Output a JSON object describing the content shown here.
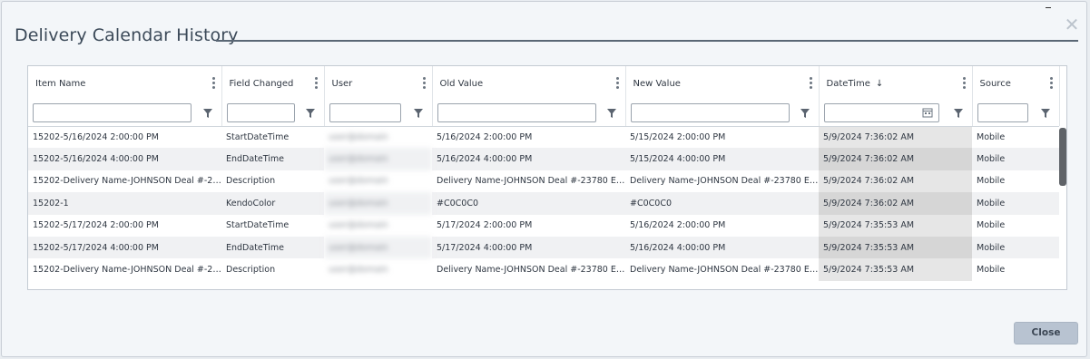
{
  "dialog": {
    "title": "Delivery Calendar History",
    "close_label": "Close"
  },
  "grid": {
    "columns": [
      {
        "label": "Item Name"
      },
      {
        "label": "Field Changed"
      },
      {
        "label": "User"
      },
      {
        "label": "Old Value"
      },
      {
        "label": "New Value"
      },
      {
        "label": "DateTime",
        "sort": "↓"
      },
      {
        "label": "Source"
      }
    ],
    "rows": [
      {
        "item": "15202-5/16/2024 2:00:00 PM",
        "field": "StartDateTime",
        "user": "user@domain",
        "old": "5/16/2024 2:00:00 PM",
        "new": "5/15/2024 2:00:00 PM",
        "datetime": "5/9/2024 7:36:02 AM",
        "source": "Mobile"
      },
      {
        "item": "15202-5/16/2024 4:00:00 PM",
        "field": "EndDateTime",
        "user": "user@domain",
        "old": "5/16/2024 4:00:00 PM",
        "new": "5/15/2024 4:00:00 PM",
        "datetime": "5/9/2024 7:36:02 AM",
        "source": "Mobile"
      },
      {
        "item": "15202-Delivery Name-JOHNSON Deal #-237...",
        "field": "Description",
        "user": "user@domain",
        "old": "Delivery Name-JOHNSON Deal #-23780 Enti...",
        "new": "Delivery Name-JOHNSON Deal #-23780 Enti...",
        "datetime": "5/9/2024 7:36:02 AM",
        "source": "Mobile"
      },
      {
        "item": "15202-1",
        "field": "KendoColor",
        "user": "user@domain",
        "old": "#C0C0C0",
        "new": "#C0C0C0",
        "datetime": "5/9/2024 7:36:02 AM",
        "source": "Mobile"
      },
      {
        "item": "15202-5/17/2024 2:00:00 PM",
        "field": "StartDateTime",
        "user": "user@domain",
        "old": "5/17/2024 2:00:00 PM",
        "new": "5/16/2024 2:00:00 PM",
        "datetime": "5/9/2024 7:35:53 AM",
        "source": "Mobile"
      },
      {
        "item": "15202-5/17/2024 4:00:00 PM",
        "field": "EndDateTime",
        "user": "user@domain",
        "old": "5/17/2024 4:00:00 PM",
        "new": "5/16/2024 4:00:00 PM",
        "datetime": "5/9/2024 7:35:53 AM",
        "source": "Mobile"
      },
      {
        "item": "15202-Delivery Name-JOHNSON Deal #-237...",
        "field": "Description",
        "user": "user@domain",
        "old": "Delivery Name-JOHNSON Deal #-23780 Enti...",
        "new": "Delivery Name-JOHNSON Deal #-23780 Enti...",
        "datetime": "5/9/2024 7:35:53 AM",
        "source": "Mobile"
      }
    ]
  },
  "icons": {
    "filter": "filter-icon",
    "column_menu": "kebab-icon",
    "calendar": "calendar-icon",
    "close": "close-icon"
  },
  "colors": {
    "title": "#3c4a59",
    "close_button_bg": "#b8c3d1",
    "scroll_thumb": "#5f6368"
  }
}
